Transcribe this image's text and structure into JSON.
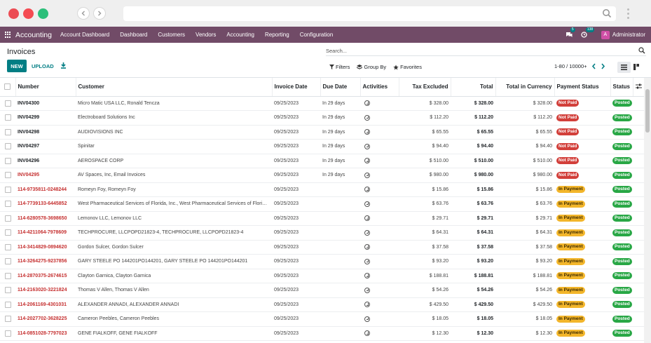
{
  "browser": {
    "dots": [
      "#ec4c54",
      "#f44b52",
      "#2cbf7a"
    ],
    "back_icon": "chevron-left-icon",
    "forward_icon": "chevron-right-icon"
  },
  "topnav": {
    "app_name": "Accounting",
    "menu": [
      "Account Dashboard",
      "Dashboard",
      "Customers",
      "Vendors",
      "Accounting",
      "Reporting",
      "Configuration"
    ],
    "messages_count": "5",
    "activities_count": "138",
    "user_initial": "A",
    "user_name": "Administrator",
    "bar_color": "#714b67"
  },
  "panel": {
    "title": "Invoices",
    "search_placeholder": "Search...",
    "new_label": "NEW",
    "upload_label": "UPLOAD",
    "filters_label": "Filters",
    "groupby_label": "Group By",
    "favorites_label": "Favorites",
    "pager": "1-80 / 10000+"
  },
  "table": {
    "headers": [
      "Number",
      "Customer",
      "Invoice Date",
      "Due Date",
      "Activities",
      "Tax Excluded",
      "Total",
      "Total in Currency",
      "Payment Status",
      "Status"
    ],
    "rows": [
      {
        "number": "INV04300",
        "customer": "Micro Matic USA LLC, Ronald Tencza",
        "invoice_date": "09/25/2023",
        "due_date": "In 29 days",
        "tax_excluded": "$ 328.00",
        "total": "$ 328.00",
        "total_currency": "$ 328.00",
        "payment_status": "Not Paid",
        "status": "Posted",
        "number_red": false
      },
      {
        "number": "INV04299",
        "customer": "Electroboard Solutions Inc",
        "invoice_date": "09/25/2023",
        "due_date": "In 29 days",
        "tax_excluded": "$ 112.20",
        "total": "$ 112.20",
        "total_currency": "$ 112.20",
        "payment_status": "Not Paid",
        "status": "Posted",
        "number_red": false
      },
      {
        "number": "INV04298",
        "customer": "AUDIOVISIONS INC",
        "invoice_date": "09/25/2023",
        "due_date": "In 29 days",
        "tax_excluded": "$ 65.55",
        "total": "$ 65.55",
        "total_currency": "$ 65.55",
        "payment_status": "Not Paid",
        "status": "Posted",
        "number_red": false
      },
      {
        "number": "INV04297",
        "customer": "Spinitar",
        "invoice_date": "09/25/2023",
        "due_date": "In 29 days",
        "tax_excluded": "$ 94.40",
        "total": "$ 94.40",
        "total_currency": "$ 94.40",
        "payment_status": "Not Paid",
        "status": "Posted",
        "number_red": false
      },
      {
        "number": "INV04296",
        "customer": "AEROSPACE CORP",
        "invoice_date": "09/25/2023",
        "due_date": "In 29 days",
        "tax_excluded": "$ 510.00",
        "total": "$ 510.00",
        "total_currency": "$ 510.00",
        "payment_status": "Not Paid",
        "status": "Posted",
        "number_red": false
      },
      {
        "number": "INV04295",
        "customer": "AV Spaces, Inc, Email Invoices",
        "invoice_date": "09/25/2023",
        "due_date": "In 29 days",
        "tax_excluded": "$ 980.00",
        "total": "$ 980.00",
        "total_currency": "$ 980.00",
        "payment_status": "Not Paid",
        "status": "Posted",
        "number_red": true
      },
      {
        "number": "114-9735811-0248244",
        "customer": "Romeyn Foy, Romeyn Foy",
        "invoice_date": "09/25/2023",
        "due_date": "",
        "tax_excluded": "$ 15.86",
        "total": "$ 15.86",
        "total_currency": "$ 15.86",
        "payment_status": "In Payment",
        "status": "Posted",
        "number_red": true
      },
      {
        "number": "114-7739133-6445852",
        "customer": "West Pharmaceutical Services of Florida, Inc., West Pharmaceutical Services of Florida, Inc.",
        "invoice_date": "09/25/2023",
        "due_date": "",
        "tax_excluded": "$ 63.76",
        "total": "$ 63.76",
        "total_currency": "$ 63.76",
        "payment_status": "In Payment",
        "status": "Posted",
        "number_red": true
      },
      {
        "number": "114-6280578-3698650",
        "customer": "Lemonov LLC, Lemonov LLC",
        "invoice_date": "09/25/2023",
        "due_date": "",
        "tax_excluded": "$ 29.71",
        "total": "$ 29.71",
        "total_currency": "$ 29.71",
        "payment_status": "In Payment",
        "status": "Posted",
        "number_red": true
      },
      {
        "number": "114-4211064-7978609",
        "customer": "TECHPROCURE, LLCPOPD21823-4, TECHPROCURE, LLCPOPD21823-4",
        "invoice_date": "09/25/2023",
        "due_date": "",
        "tax_excluded": "$ 64.31",
        "total": "$ 64.31",
        "total_currency": "$ 64.31",
        "payment_status": "In Payment",
        "status": "Posted",
        "number_red": true
      },
      {
        "number": "114-3414829-0894620",
        "customer": "Gordon Sulcer, Gordon Sulcer",
        "invoice_date": "09/25/2023",
        "due_date": "",
        "tax_excluded": "$ 37.58",
        "total": "$ 37.58",
        "total_currency": "$ 37.58",
        "payment_status": "In Payment",
        "status": "Posted",
        "number_red": true
      },
      {
        "number": "114-3264275-9237856",
        "customer": "GARY STEELE PO 144201PO144201, GARY STEELE PO 144201PO144201",
        "invoice_date": "09/25/2023",
        "due_date": "",
        "tax_excluded": "$ 93.20",
        "total": "$ 93.20",
        "total_currency": "$ 93.20",
        "payment_status": "In Payment",
        "status": "Posted",
        "number_red": true
      },
      {
        "number": "114-2870375-2674615",
        "customer": "Clayton Garnica, Clayton Garnica",
        "invoice_date": "09/25/2023",
        "due_date": "",
        "tax_excluded": "$ 188.81",
        "total": "$ 188.81",
        "total_currency": "$ 188.81",
        "payment_status": "In Payment",
        "status": "Posted",
        "number_red": true
      },
      {
        "number": "114-2163020-3221824",
        "customer": "Thomas V Allen, Thomas V Allen",
        "invoice_date": "09/25/2023",
        "due_date": "",
        "tax_excluded": "$ 54.26",
        "total": "$ 54.26",
        "total_currency": "$ 54.26",
        "payment_status": "In Payment",
        "status": "Posted",
        "number_red": true
      },
      {
        "number": "114-2061169-4301031",
        "customer": "ALEXANDER ANNADI, ALEXANDER ANNADI",
        "invoice_date": "09/25/2023",
        "due_date": "",
        "tax_excluded": "$ 429.50",
        "total": "$ 429.50",
        "total_currency": "$ 429.50",
        "payment_status": "In Payment",
        "status": "Posted",
        "number_red": true
      },
      {
        "number": "114-2027702-3628225",
        "customer": "Cameron Peebles, Cameron Peebles",
        "invoice_date": "09/25/2023",
        "due_date": "",
        "tax_excluded": "$ 18.05",
        "total": "$ 18.05",
        "total_currency": "$ 18.05",
        "payment_status": "In Payment",
        "status": "Posted",
        "number_red": true
      },
      {
        "number": "114-0851028-7797023",
        "customer": "GENE FIALKOFF, GENE FIALKOFF",
        "invoice_date": "09/25/2023",
        "due_date": "",
        "tax_excluded": "$ 12.30",
        "total": "$ 12.30",
        "total_currency": "$ 12.30",
        "payment_status": "In Payment",
        "status": "Posted",
        "number_red": true
      }
    ]
  },
  "colors": {
    "accent": "#017e84",
    "not_paid": "#d23f3a",
    "in_payment": "#f3b62b",
    "posted": "#28a745",
    "red_number": "#c53030"
  }
}
